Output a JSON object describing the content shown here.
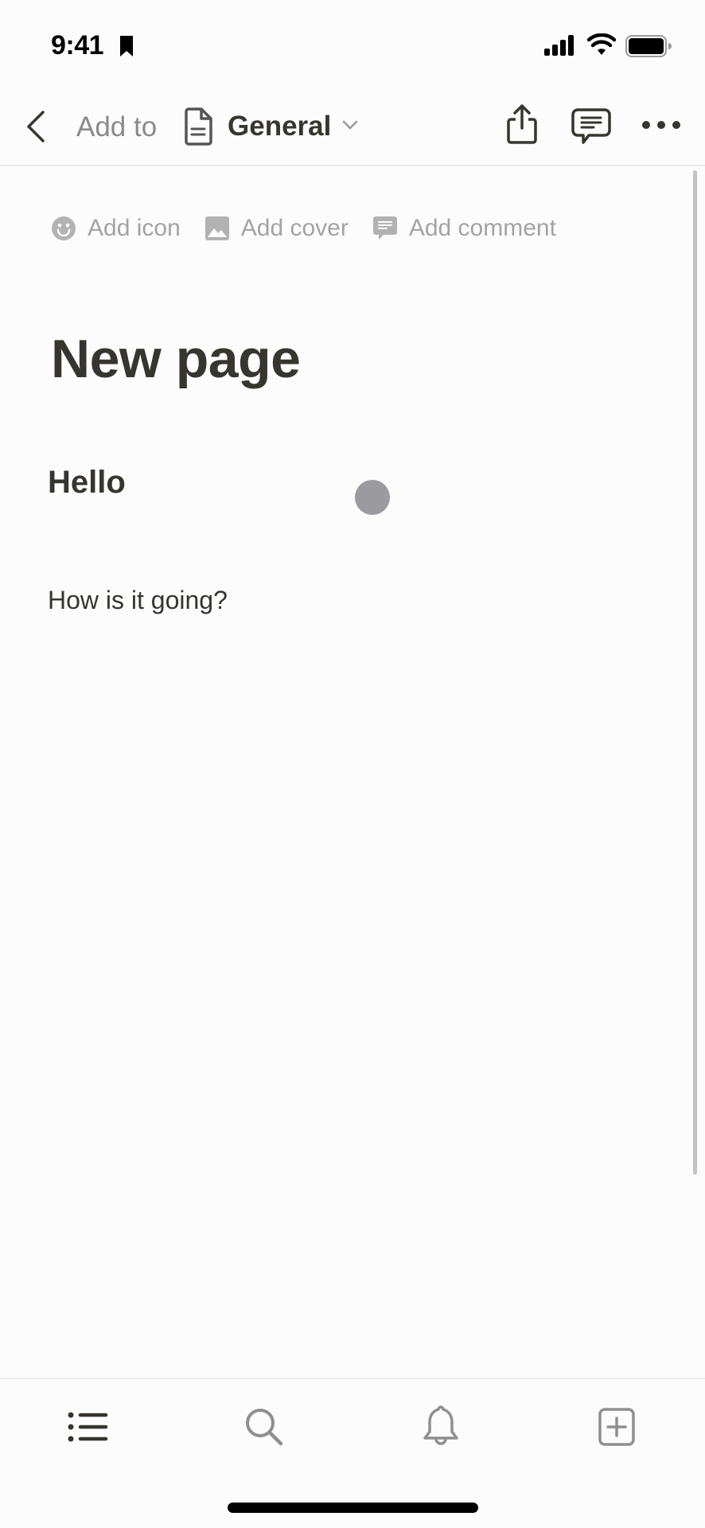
{
  "status_bar": {
    "time": "9:41",
    "icons": [
      "bookmark-icon",
      "cellular-signal-icon",
      "wifi-icon",
      "battery-icon"
    ]
  },
  "nav": {
    "back_icon": "chevron-left-icon",
    "add_to_label": "Add to",
    "workspace_icon": "document-icon",
    "workspace_name": "General",
    "dropdown_icon": "chevron-down-icon",
    "actions": [
      "share-icon",
      "comment-icon",
      "more-icon"
    ]
  },
  "page_actions": [
    {
      "icon": "smiley-icon",
      "label": "Add icon"
    },
    {
      "icon": "image-icon",
      "label": "Add cover"
    },
    {
      "icon": "comment-icon",
      "label": "Add comment"
    }
  ],
  "page": {
    "title": "New page",
    "blocks": [
      {
        "type": "heading",
        "text": "Hello"
      },
      {
        "type": "text",
        "text": "How is it going?"
      }
    ]
  },
  "tab_bar": {
    "tabs": [
      {
        "name": "pages",
        "icon": "list-icon",
        "active": true
      },
      {
        "name": "search",
        "icon": "search-icon",
        "active": false
      },
      {
        "name": "inbox",
        "icon": "bell-icon",
        "active": false
      },
      {
        "name": "new-page",
        "icon": "new-page-icon",
        "active": false
      }
    ]
  },
  "colors": {
    "text": "#37352f",
    "muted": "#a3a3a3",
    "background": "#fdfcfd",
    "touch_indicator": "#9b9a9f"
  }
}
